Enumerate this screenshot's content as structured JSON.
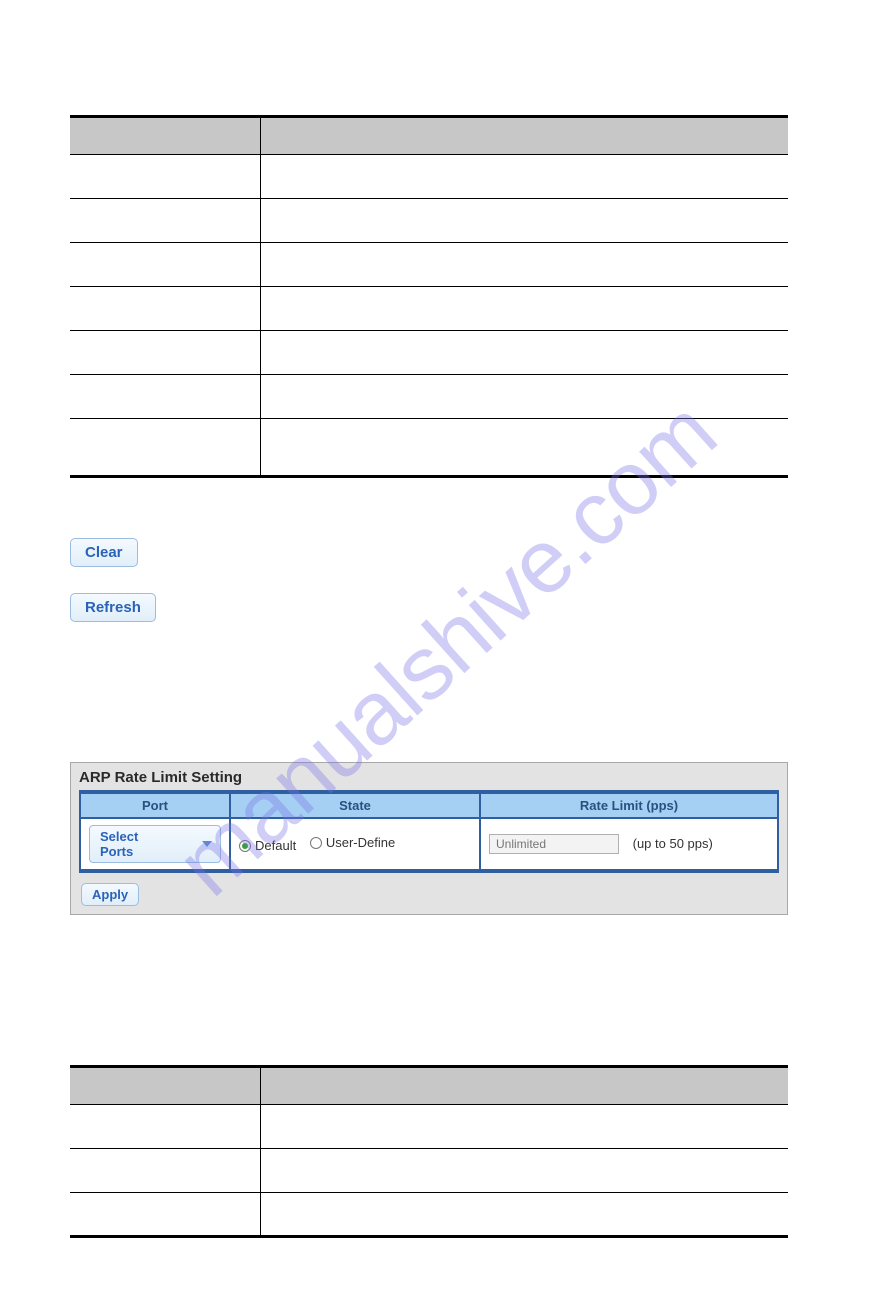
{
  "watermark": "manualshive.com",
  "buttons": {
    "clear": "Clear",
    "refresh": "Refresh",
    "apply": "Apply"
  },
  "panel": {
    "title": "ARP Rate Limit Setting",
    "headers": {
      "port": "Port",
      "state": "State",
      "rate_limit": "Rate Limit (pps)"
    },
    "select_label": "Select Ports",
    "state_options": {
      "default": "Default",
      "user_define": "User-Define"
    },
    "rate_placeholder": "Unlimited",
    "rate_note": "(up to 50 pps)"
  }
}
